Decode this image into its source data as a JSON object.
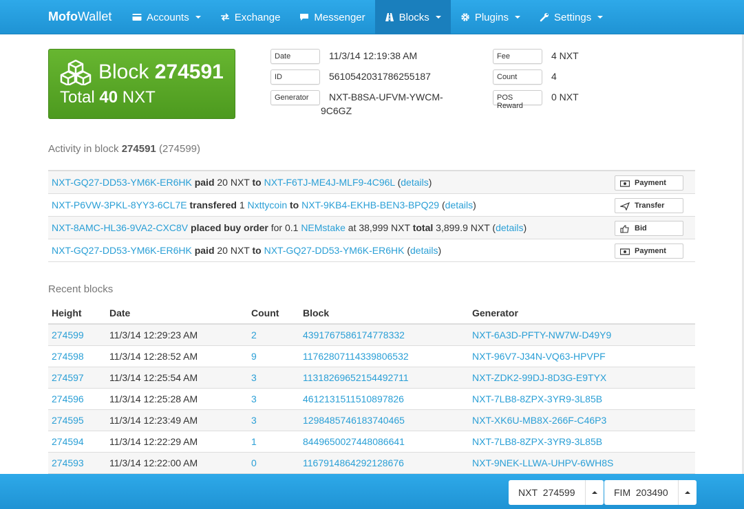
{
  "brand": {
    "bold": "Mofo",
    "rest": "Wallet"
  },
  "nav": [
    {
      "label": "Accounts",
      "icon": "credit-card-icon",
      "dropdown": true
    },
    {
      "label": "Exchange",
      "icon": "exchange-icon",
      "dropdown": false
    },
    {
      "label": "Messenger",
      "icon": "comment-icon",
      "dropdown": false
    },
    {
      "label": "Blocks",
      "icon": "road-icon",
      "dropdown": true,
      "active": true
    },
    {
      "label": "Plugins",
      "icon": "gear-icon",
      "dropdown": true
    },
    {
      "label": "Settings",
      "icon": "wrench-icon",
      "dropdown": true
    }
  ],
  "block": {
    "prefix": "Block",
    "height": "274591",
    "total_prefix": "Total",
    "total_amount": "40",
    "total_unit": "NXT"
  },
  "details": {
    "date_label": "Date",
    "date_value": "11/3/14 12:19:38 AM",
    "id_label": "ID",
    "id_value": "5610542031786255187",
    "generator_label": "Generator",
    "generator_value_1": "NXT-B8SA-UFVM-YWCM-",
    "generator_value_2": "9C6GZ",
    "fee_label": "Fee",
    "fee_value": "4 NXT",
    "count_label": "Count",
    "count_value": "4",
    "pos_label": "POS Reward",
    "pos_value": "0 NXT"
  },
  "activity": {
    "heading_prefix": "Activity in block",
    "heading_block": "274591",
    "heading_suffix": "(274599)",
    "rows": [
      {
        "parts": [
          [
            "link",
            "NXT-GQ27-DD53-YM6K-ER6HK"
          ],
          [
            "text",
            " "
          ],
          [
            "bold",
            "paid"
          ],
          [
            "text",
            " 20 NXT "
          ],
          [
            "bold",
            "to"
          ],
          [
            "text",
            " "
          ],
          [
            "link",
            "NXT-F6TJ-ME4J-MLF9-4C96L"
          ],
          [
            "text",
            " ("
          ],
          [
            "link",
            "details"
          ],
          [
            "text",
            ")"
          ]
        ],
        "button": "Payment",
        "icon": "money-icon"
      },
      {
        "parts": [
          [
            "link",
            "NXT-P6VW-3PKL-8YY3-6CL7E"
          ],
          [
            "text",
            " "
          ],
          [
            "bold",
            "transfered"
          ],
          [
            "text",
            " 1 "
          ],
          [
            "link",
            "Nxttycoin"
          ],
          [
            "text",
            " "
          ],
          [
            "bold",
            "to"
          ],
          [
            "text",
            " "
          ],
          [
            "link",
            "NXT-9KB4-EKHB-BEN3-BPQ29"
          ],
          [
            "text",
            " ("
          ],
          [
            "link",
            "details"
          ],
          [
            "text",
            ")"
          ]
        ],
        "button": "Transfer",
        "icon": "send-icon"
      },
      {
        "parts": [
          [
            "link",
            "NXT-8AMC-HL36-9VA2-CXC8V"
          ],
          [
            "text",
            " "
          ],
          [
            "bold",
            "placed buy order"
          ],
          [
            "text",
            " for 0.1 "
          ],
          [
            "link",
            "NEMstake"
          ],
          [
            "text",
            " at 38,999 NXT "
          ],
          [
            "bold",
            "total"
          ],
          [
            "text",
            " 3,899.9 NXT ("
          ],
          [
            "link",
            "details"
          ],
          [
            "text",
            ")"
          ]
        ],
        "button": "Bid",
        "icon": "thumbs-up-icon"
      },
      {
        "parts": [
          [
            "link",
            "NXT-GQ27-DD53-YM6K-ER6HK"
          ],
          [
            "text",
            " "
          ],
          [
            "bold",
            "paid"
          ],
          [
            "text",
            " 20 NXT "
          ],
          [
            "bold",
            "to"
          ],
          [
            "text",
            " "
          ],
          [
            "link",
            "NXT-GQ27-DD53-YM6K-ER6HK"
          ],
          [
            "text",
            " ("
          ],
          [
            "link",
            "details"
          ],
          [
            "text",
            ")"
          ]
        ],
        "button": "Payment",
        "icon": "money-icon"
      }
    ]
  },
  "recent": {
    "heading": "Recent blocks",
    "columns": [
      "Height",
      "Date",
      "Count",
      "Block",
      "Generator"
    ],
    "rows": [
      [
        "274599",
        "11/3/14 12:29:23 AM",
        "2",
        "4391767586174778332",
        "NXT-6A3D-PFTY-NW7W-D49Y9"
      ],
      [
        "274598",
        "11/3/14 12:28:52 AM",
        "9",
        "11762807114339806532",
        "NXT-96V7-J34N-VQ63-HPVPF"
      ],
      [
        "274597",
        "11/3/14 12:25:54 AM",
        "3",
        "11318269652154492711",
        "NXT-ZDK2-99DJ-8D3G-E9TYX"
      ],
      [
        "274596",
        "11/3/14 12:25:28 AM",
        "3",
        "4612131511510897826",
        "NXT-7LB8-8ZPX-3YR9-3L85B"
      ],
      [
        "274595",
        "11/3/14 12:23:49 AM",
        "3",
        "1298485746183740465",
        "NXT-XK6U-MB8X-266F-C46P3"
      ],
      [
        "274594",
        "11/3/14 12:22:29 AM",
        "1",
        "8449650027448086641",
        "NXT-7LB8-8ZPX-3YR9-3L85B"
      ],
      [
        "274593",
        "11/3/14 12:22:00 AM",
        "0",
        "1167914864292128676",
        "NXT-9NEK-LLWA-UHPV-6WH8S"
      ]
    ]
  },
  "footer": {
    "nxt_label": "NXT",
    "nxt_value": "274599",
    "fim_label": "FIM",
    "fim_value": "203490"
  },
  "colors": {
    "accent": "#2a9fd6",
    "navbar": "#1f93d4",
    "block_green": "#5aa927"
  }
}
